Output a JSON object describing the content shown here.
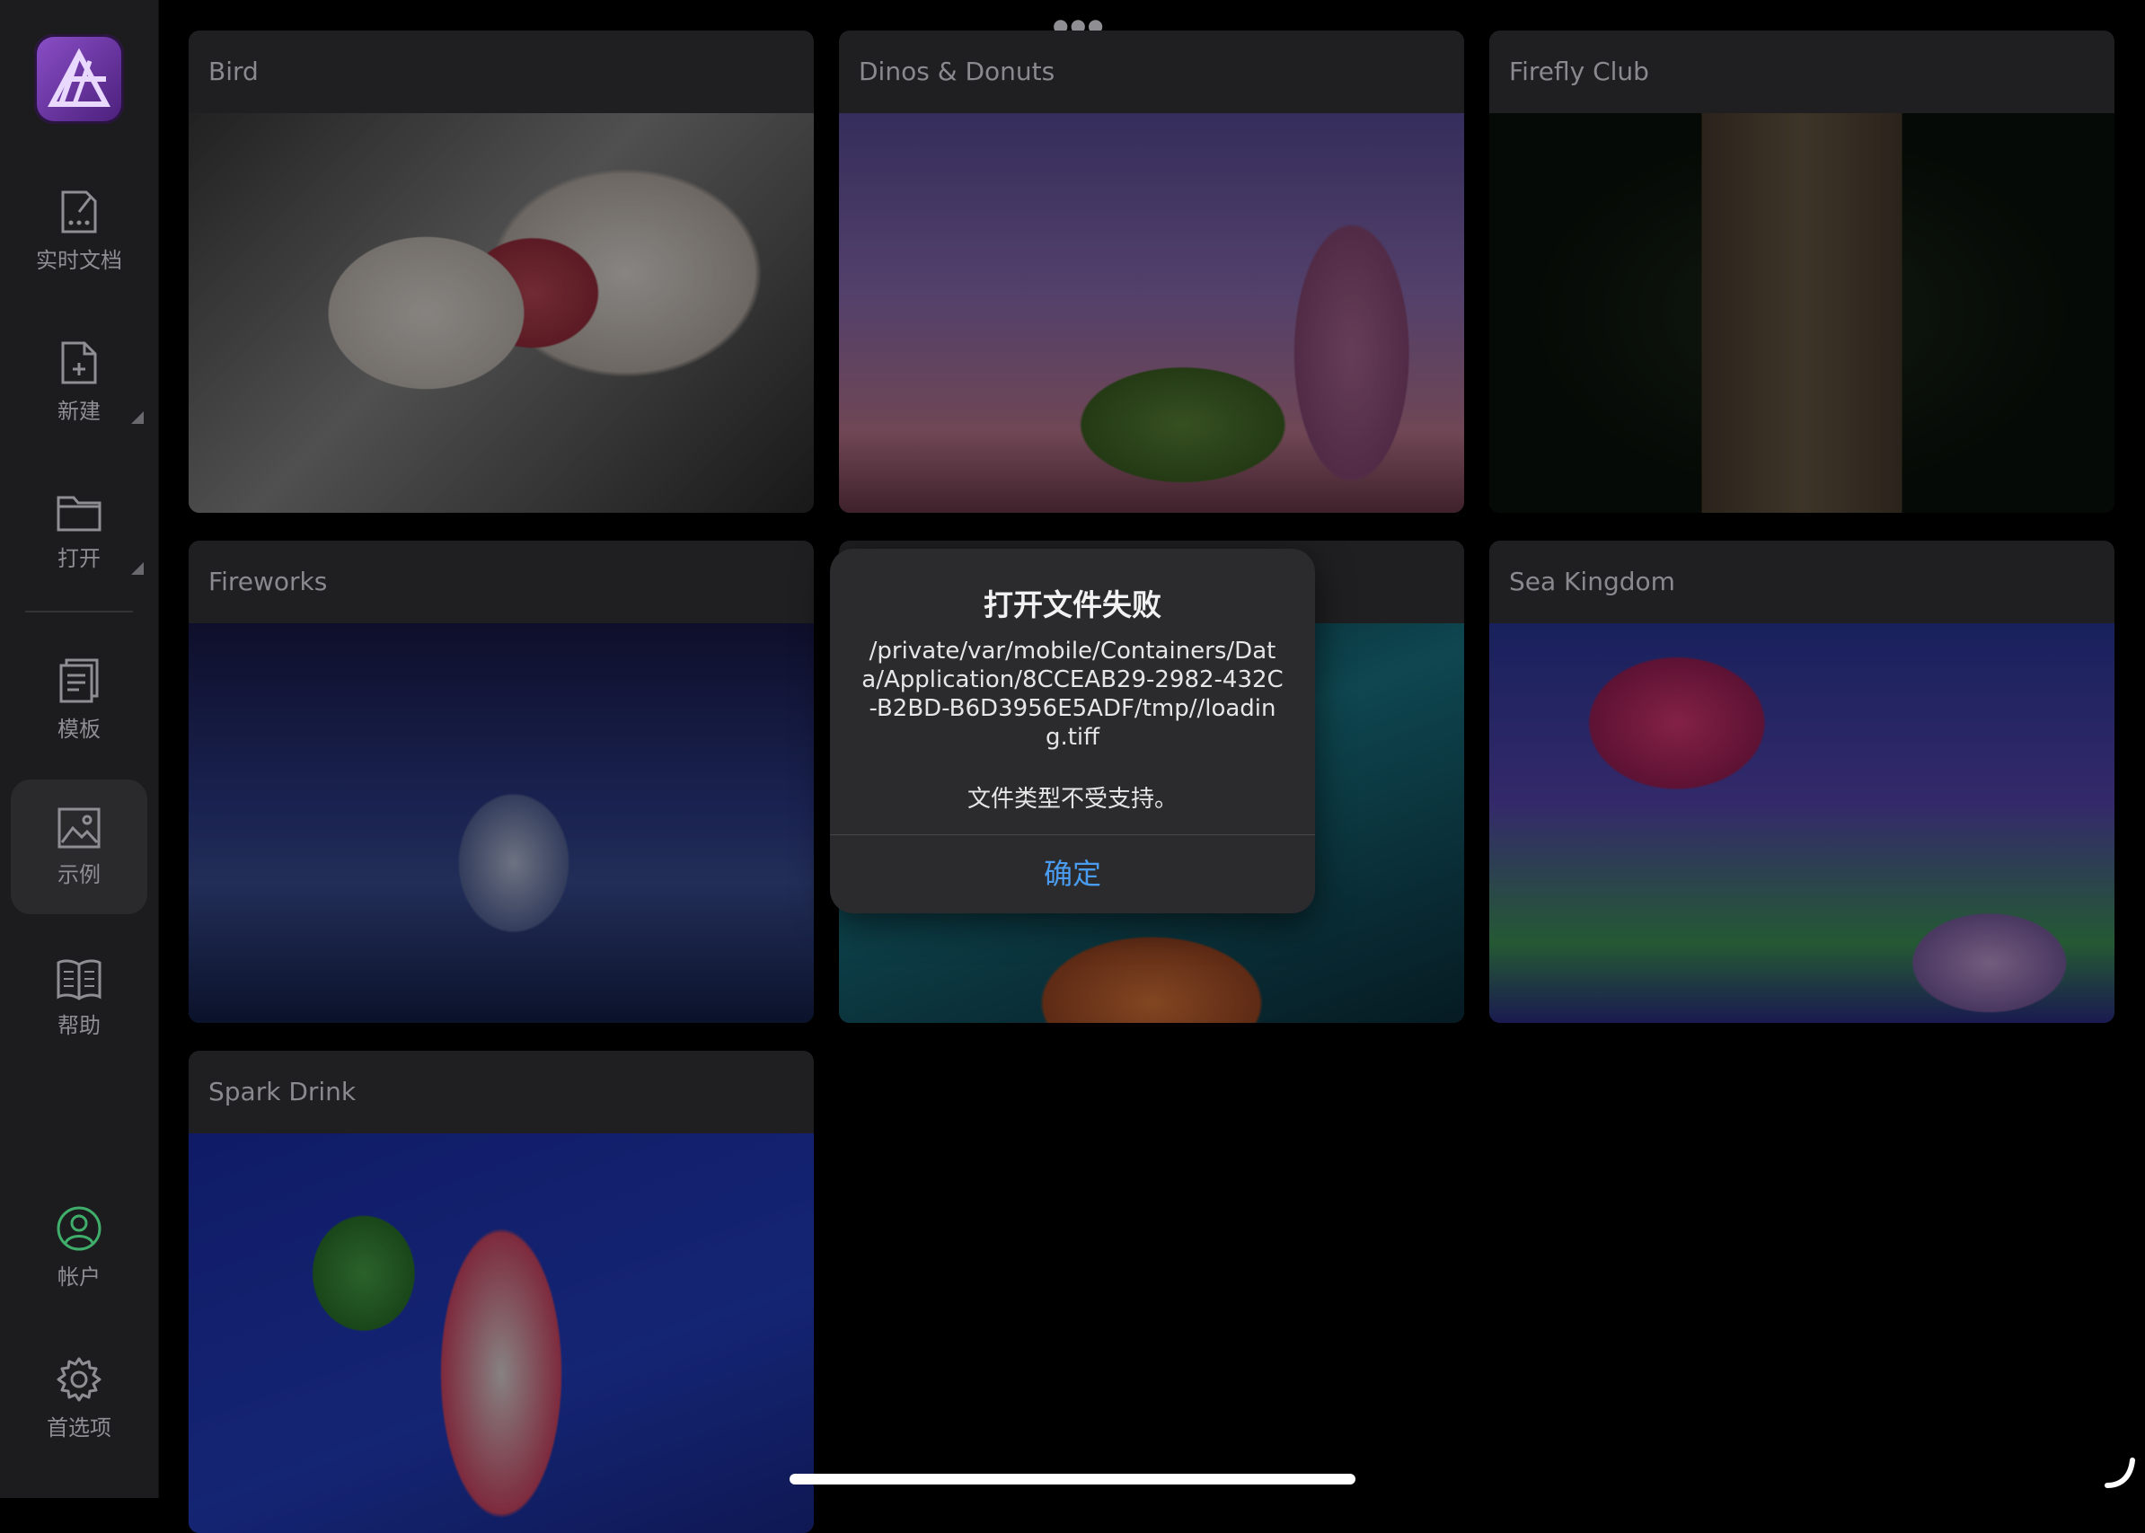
{
  "sidebar": {
    "items": [
      {
        "label": "实时文档",
        "icon": "live-document-icon",
        "active": false
      },
      {
        "label": "新建",
        "icon": "new-document-icon",
        "active": false
      },
      {
        "label": "打开",
        "icon": "open-folder-icon",
        "active": false
      },
      {
        "label": "模板",
        "icon": "templates-icon",
        "active": false
      },
      {
        "label": "示例",
        "icon": "samples-image-icon",
        "active": true
      },
      {
        "label": "帮助",
        "icon": "help-book-icon",
        "active": false
      },
      {
        "label": "帐户",
        "icon": "account-icon",
        "active": false
      },
      {
        "label": "首选项",
        "icon": "preferences-gear-icon",
        "active": false
      }
    ]
  },
  "grid": {
    "cards": [
      {
        "title": "Bird"
      },
      {
        "title": "Dinos & Donuts"
      },
      {
        "title": "Firefly Club"
      },
      {
        "title": "Fireworks"
      },
      {
        "title": ""
      },
      {
        "title": "Sea Kingdom"
      },
      {
        "title": "Spark Drink"
      }
    ]
  },
  "dialog": {
    "title": "打开文件失败",
    "path": "/private/var/mobile/Containers/Data/Application/8CCEAB29-2982-432C-B2BD-B6D3956E5ADF/tmp//loading.tiff",
    "message": "文件类型不受支持。",
    "button": "确定"
  },
  "colors": {
    "accent": "#4a9cf0",
    "brand": "#8b4fc8",
    "account": "#3fae6a"
  }
}
